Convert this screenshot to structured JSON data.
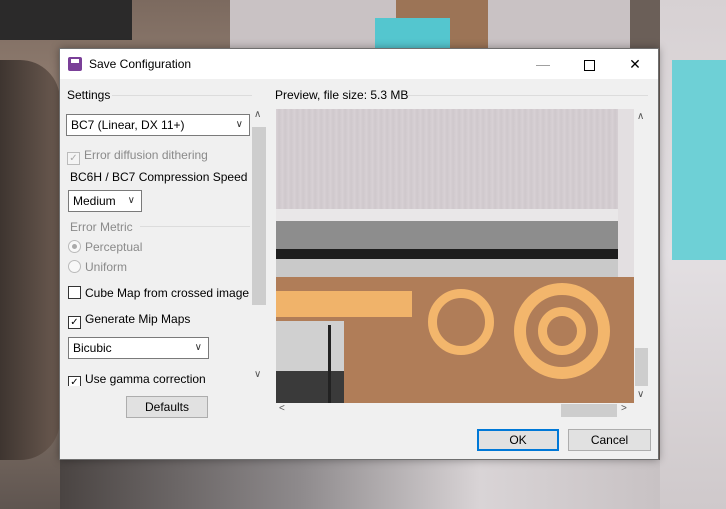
{
  "window": {
    "title": "Save Configuration"
  },
  "settings": {
    "heading": "Settings",
    "format": "BC7 (Linear, DX 11+)",
    "error_diffusion_label": "Error diffusion dithering",
    "error_diffusion_checked": true,
    "compression_speed_label": "BC6H / BC7 Compression Speed",
    "compression_speed": "Medium",
    "error_metric_label": "Error Metric",
    "metric_options": [
      {
        "label": "Perceptual",
        "selected": true
      },
      {
        "label": "Uniform",
        "selected": false
      }
    ],
    "cube_map_label": "Cube Map from crossed image",
    "cube_map_checked": false,
    "mipmaps_label": "Generate Mip Maps",
    "mipmaps_checked": true,
    "mip_filter": "Bicubic",
    "gamma_label": "Use gamma correction",
    "gamma_checked": true,
    "defaults_button": "Defaults"
  },
  "preview": {
    "heading": "Preview, file size: 5.3 MB"
  },
  "buttons": {
    "ok": "OK",
    "cancel": "Cancel"
  },
  "colors": {
    "accent": "#0078d7",
    "dialog_bg": "#f0f0f0"
  }
}
